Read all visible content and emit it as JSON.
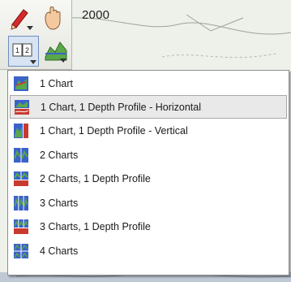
{
  "chart": {
    "depth_label": "2000"
  },
  "toolbar": {
    "tools": [
      {
        "icon": "pencil-icon"
      },
      {
        "icon": "pan-hand-icon"
      },
      {
        "icon": "chart-layout-icon"
      },
      {
        "icon": "depth-profile-icon"
      }
    ]
  },
  "layout_menu": {
    "items": [
      {
        "label": "1 Chart",
        "icon": "one-chart-icon"
      },
      {
        "label": "1 Chart, 1 Depth Profile - Horizontal",
        "icon": "chart-horizontal-profile-icon",
        "highlighted": true
      },
      {
        "label": "1 Chart, 1 Depth Profile - Vertical",
        "icon": "chart-vertical-profile-icon"
      },
      {
        "label": "2 Charts",
        "icon": "two-charts-icon"
      },
      {
        "label": "2 Charts, 1 Depth Profile",
        "icon": "two-charts-profile-icon"
      },
      {
        "label": "3 Charts",
        "icon": "three-charts-icon"
      },
      {
        "label": "3 Charts, 1 Depth Profile",
        "icon": "three-charts-profile-icon"
      },
      {
        "label": "4 Charts",
        "icon": "four-charts-icon"
      }
    ]
  },
  "colors": {
    "menu_highlight": "#e9e9e9",
    "icon_blue": "#3a62c8",
    "icon_red": "#c83a2e",
    "icon_green": "#5aa84a"
  }
}
